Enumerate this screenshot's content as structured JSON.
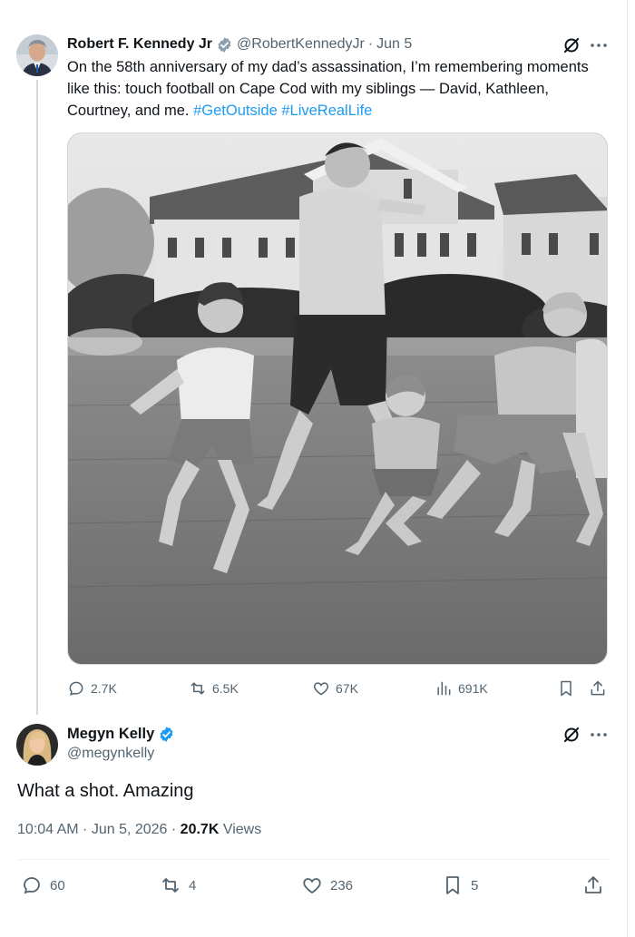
{
  "parent": {
    "name": "Robert F. Kennedy Jr",
    "handle": "@RobertKennedyJr",
    "separator": "·",
    "date": "Jun 5",
    "text_main": "On the 58th anniversary of my dad’s assassination, I’m remembering moments like this: touch football on Cape Cod with my siblings — David, Kathleen, Courtney, and me.",
    "hashtag_1": "#GetOutside",
    "hashtag_2": "#LiveRealLife",
    "stats": {
      "replies": "2.7K",
      "reposts": "6.5K",
      "likes": "67K",
      "views": "691K"
    }
  },
  "reply": {
    "name": "Megyn Kelly",
    "handle": "@megynkelly",
    "text": "What a shot. Amazing",
    "time": "10:04 AM · Jun 5, 2026 ·",
    "views_count": "20.7K",
    "views_label": "Views",
    "stats": {
      "replies": "60",
      "reposts": "4",
      "likes": "236",
      "bookmarks": "5"
    }
  },
  "icons": {
    "verified": "verified-badge-icon",
    "grok": "grok-icon",
    "more": "more-icon",
    "reply": "reply-icon",
    "repost": "repost-icon",
    "like": "like-icon",
    "views": "views-icon",
    "bookmark": "bookmark-icon",
    "share": "share-icon"
  },
  "colors": {
    "accent": "#1d9bf0",
    "text": "#0f1419",
    "secondary": "#536471",
    "border": "#cfd9de"
  }
}
